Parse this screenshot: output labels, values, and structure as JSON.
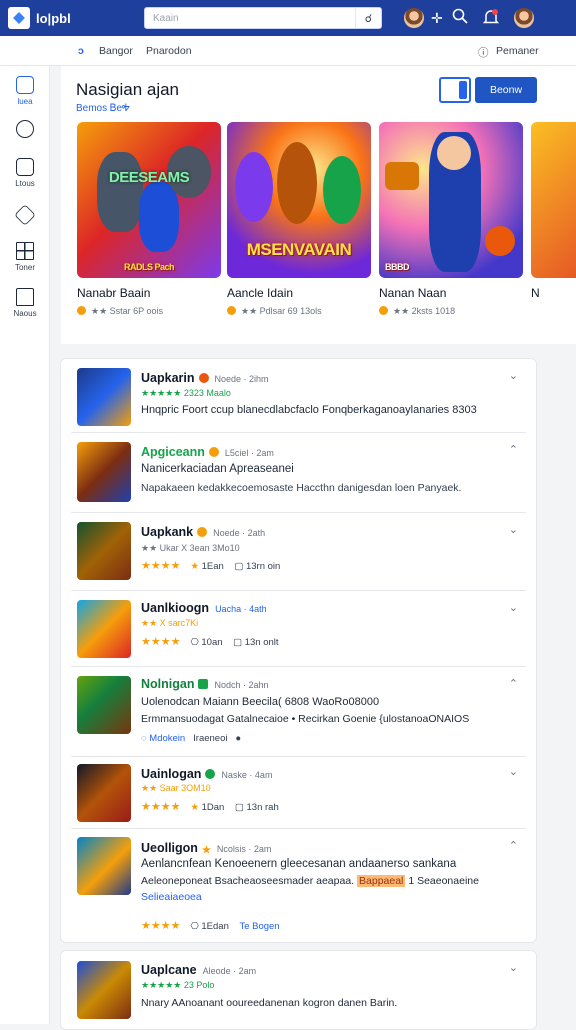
{
  "topbar": {
    "brand": "lo|pbl",
    "search_placeholder": "Kaain",
    "search_button": "☌",
    "icons": [
      "avatar",
      "plus-icon",
      "search-icon",
      "notifications-icon",
      "avatar"
    ]
  },
  "subnav": {
    "left_icon": "ↄ",
    "item1": "Bangor",
    "item2": "Pnarodon",
    "right_icon": "ⓘ",
    "right_label": "Pemaner"
  },
  "sidebar": {
    "items": [
      {
        "label": "luea",
        "icon": "home-icon"
      },
      {
        "label": "",
        "icon": "compass-icon"
      },
      {
        "label": "Ltous",
        "icon": "library-icon"
      },
      {
        "label": "",
        "icon": "tag-icon"
      },
      {
        "label": "Toner",
        "icon": "grid-icon"
      },
      {
        "label": "Naous",
        "icon": "house-icon"
      }
    ]
  },
  "hero": {
    "title": "Nasigian ajan",
    "subtitle": "Bemos ᏴeᎭ",
    "browse_label": "Beonw",
    "games": [
      {
        "name": "Nanabr Baain",
        "meta": "★★ Sstar 6P oois",
        "cover_text": "DEESEAMS",
        "cover_sub": "RADLS Pach"
      },
      {
        "name": "Aancle Idain",
        "meta": "★★ Pdlsar 69 13ols",
        "cover_text": "MSENVAVAIN",
        "cover_sub": ""
      },
      {
        "name": "Nanan Naan",
        "meta": "★★ 2ksts 1018",
        "cover_text": "",
        "cover_sub": "BBBD"
      },
      {
        "name": "N",
        "meta": "",
        "cover_text": "",
        "cover_sub": ""
      }
    ]
  },
  "list": [
    {
      "title": "Uapkarin",
      "meta": "Noede · 2ihm",
      "sub": "★★★★★ 2323 Maalo",
      "desc": "Hnqpric Foort ccup blanecdlabcfaclo Fonqberkaganoaylanaries 8303",
      "chevron": "⌄"
    },
    {
      "title": "Apgiceann",
      "meta": "L5ciel · 2am",
      "sub": "",
      "desc": "Nanicerkaciadan Apreaseanei",
      "desc2": "Napakaeen kedakkecoemosaste Haccthn danigesdan loen Panyaek.",
      "chevron": "⌃"
    },
    {
      "title": "Uapkank",
      "meta": "Noede · 2ath",
      "sub": "★★ Ukar X 3ean 3Mo10",
      "info_stars": "★★★★",
      "info_a": "1Ean",
      "info_b": "13rn oin",
      "chevron": "⌄"
    },
    {
      "title": "Uanlkioogn",
      "meta": "Uacha · 4ath",
      "sub": "★★ X sarc7Ki",
      "info_stars": "★★★★",
      "info_a": "10an",
      "info_b": "13n onlt",
      "chevron": "⌄"
    },
    {
      "title": "Nolnigan",
      "meta": "Nodch · 2ahn",
      "sub": "",
      "desc": "Uolenodcan Maiann Beecila( 6808 WaoRo08000",
      "desc2": "Ermmansuodagat Gatalnecaioe • Recirkan Goenie {ulostanoaONAIOS",
      "link": "Mdokein",
      "link2": "Iraeneoi",
      "chevron": "⌃"
    },
    {
      "title": "Uainlogan",
      "meta": "Naske · 4am",
      "sub": "★★ Saar 3OM10",
      "info_stars": "★★★★",
      "info_a": "1Dan",
      "info_b": "13n rah",
      "chevron": "⌄"
    },
    {
      "title": "Ueolligon",
      "meta": "Ncolsis · 2am",
      "sub": "",
      "desc": "Aenlancnfean Kenoeenern gleecesanan andaanerso sankana",
      "desc2_a": "Aeleoneponeat Bsacheaoseesmader aeapaa.",
      "desc2_hl": "Bappaeal",
      "desc2_b": "1 Seaeonaeine",
      "desc3": "Selieaiaeoea",
      "info_stars": "★★★★",
      "info_a": "1Edan",
      "info_link": "Te Bogen",
      "chevron": "⌃"
    }
  ],
  "list2": {
    "title": "Uaplcane",
    "meta": "Aleode · 2am",
    "sub": "★★★★★ 23 Polo",
    "desc": "Nnary AAnoanant ooureedanenan kogron danen Barin.",
    "chevron": "⌄"
  }
}
